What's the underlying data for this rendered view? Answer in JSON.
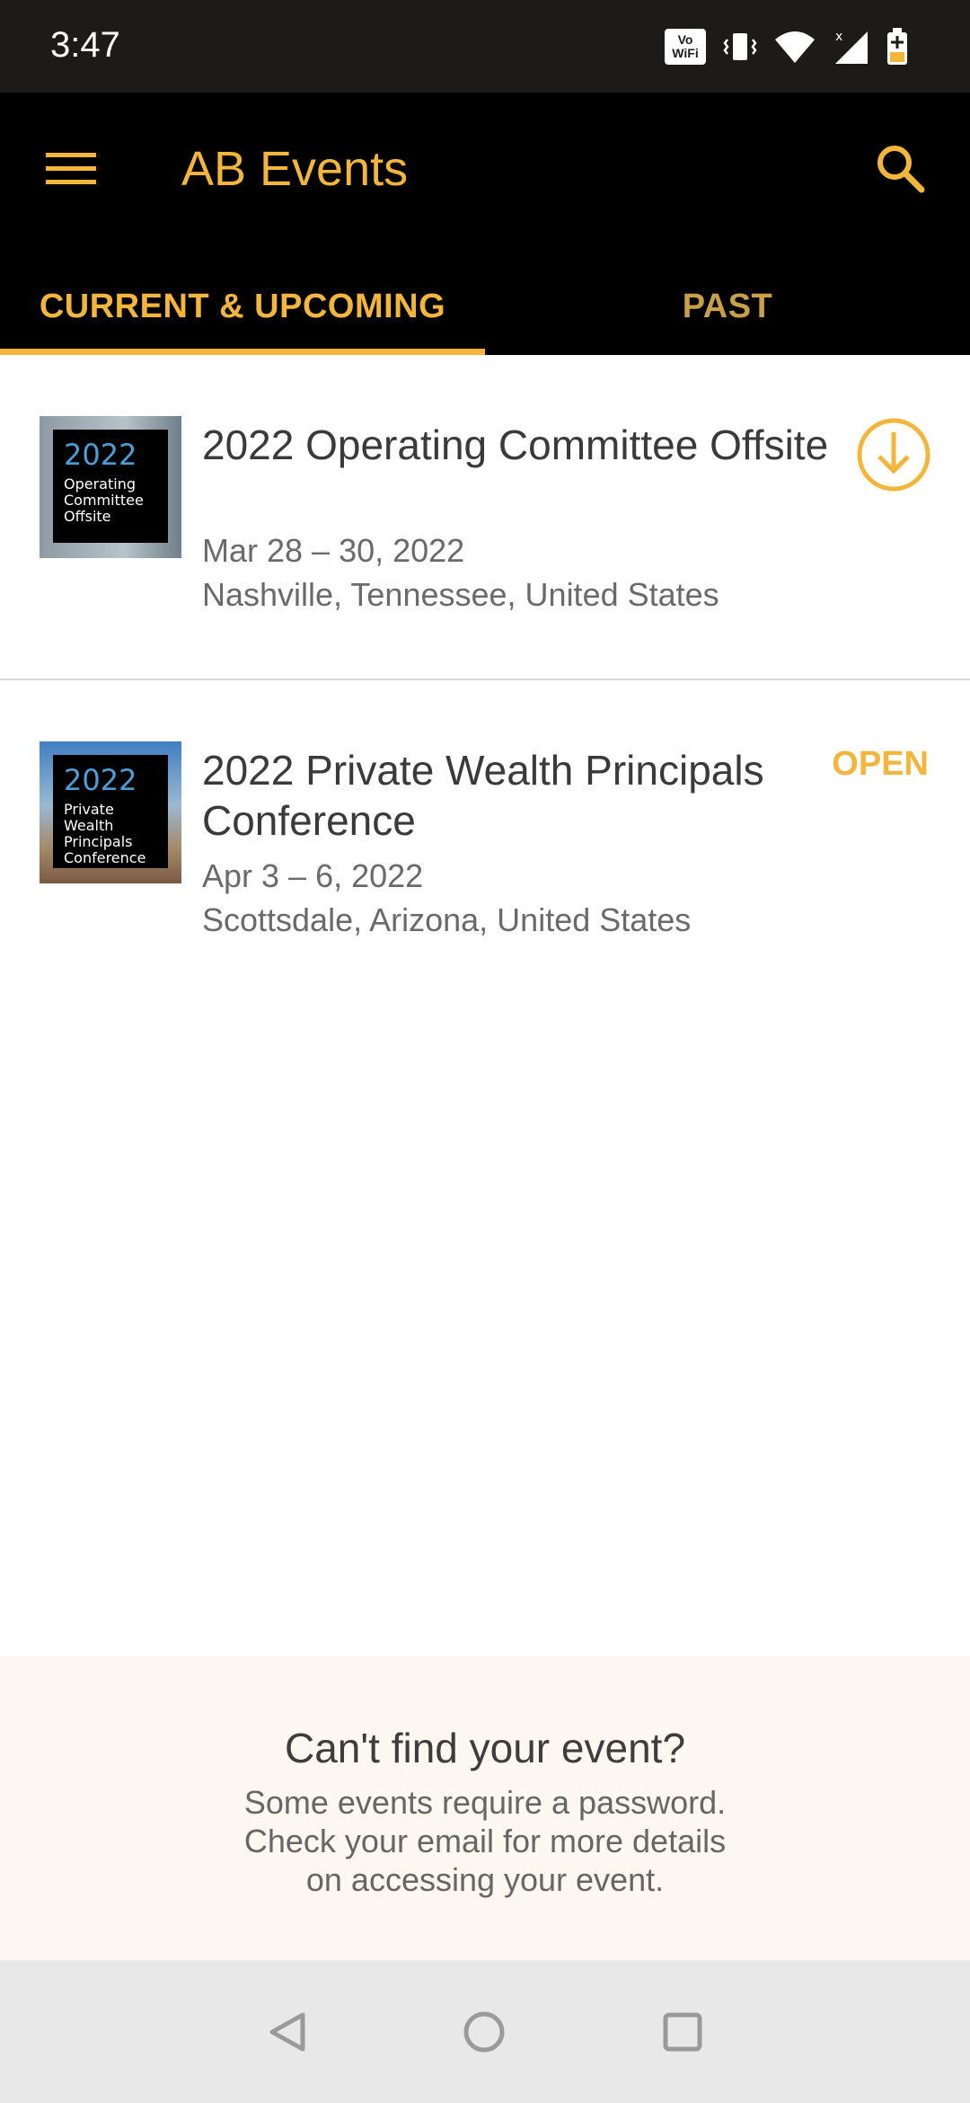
{
  "status_bar": {
    "time": "3:47",
    "icons": [
      "vowifi-icon",
      "vibrate-icon",
      "wifi-icon",
      "signal-icon",
      "battery-charging-icon"
    ],
    "vowifi_top": "Vo",
    "vowifi_bottom": "WiFi"
  },
  "app_bar": {
    "title": "AB Events",
    "menu_icon": "hamburger-menu-icon",
    "search_icon": "search-icon"
  },
  "tabs": [
    {
      "label": "CURRENT & UPCOMING",
      "active": true
    },
    {
      "label": "PAST",
      "active": false
    }
  ],
  "events": [
    {
      "title": "2022 Operating Committee Offsite",
      "dates": "Mar 28 – 30, 2022",
      "location": "Nashville, Tennessee, United States",
      "thumb_year": "2022",
      "thumb_lines": "Operating Committee Offsite",
      "action_icon": "download-icon"
    },
    {
      "title": "2022 Private Wealth Principals Conference",
      "dates": "Apr 3 – 6, 2022",
      "location": "Scottsdale, Arizona, United States",
      "thumb_year": "2022",
      "thumb_lines": "Private Wealth Principals Conference",
      "action_label": "OPEN"
    }
  ],
  "help": {
    "title": "Can't find your event?",
    "line1": "Some events require a password.",
    "line2": "Check your email for more details",
    "line3": "on accessing your event."
  },
  "nav_bar": {
    "icons": [
      "back-icon",
      "home-icon",
      "recents-icon"
    ]
  },
  "colors": {
    "accent": "#f3b63a",
    "app_bar": "#000000",
    "help_bg": "#fcf8ef"
  }
}
